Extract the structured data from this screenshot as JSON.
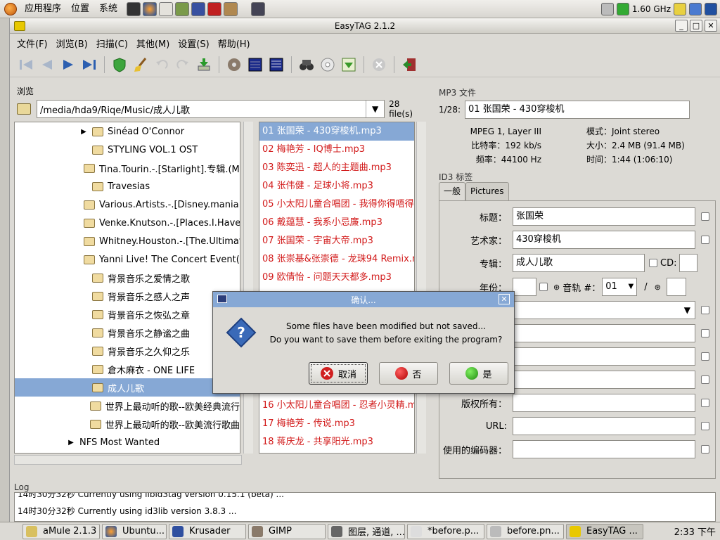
{
  "topbar": {
    "menu": [
      "应用程序",
      "位置",
      "系统"
    ],
    "cpu": "1.60 GHz"
  },
  "window": {
    "title": "EasyTAG 2.1.2"
  },
  "menubar": [
    "文件(F)",
    "浏览(B)",
    "扫描(C)",
    "其他(M)",
    "设置(S)",
    "帮助(H)"
  ],
  "browser": {
    "title": "浏览",
    "path": "/media/hda9/Riqe/Music/成人儿歌",
    "count": "28 file(s)",
    "tree": [
      {
        "label": "Sinéad O'Connor",
        "indent": 1,
        "expander": true
      },
      {
        "label": "STYLING VOL.1 OST",
        "indent": 1
      },
      {
        "label": "Tina.Tourin.-.[Starlight].专辑.(MP",
        "indent": 1
      },
      {
        "label": "Travesias",
        "indent": 1
      },
      {
        "label": "Various.Artists.-.[Disney.mania.5",
        "indent": 1
      },
      {
        "label": "Venke.Knutson.-.[Places.I.Have.B",
        "indent": 1
      },
      {
        "label": "Whitney.Houston.-.[The.Ultimat",
        "indent": 1
      },
      {
        "label": "Yanni Live! The Concert Event(3",
        "indent": 1
      },
      {
        "label": "背景音乐之爱情之歌",
        "indent": 1
      },
      {
        "label": "背景音乐之感人之声",
        "indent": 1
      },
      {
        "label": "背景音乐之恢弘之章",
        "indent": 1
      },
      {
        "label": "背景音乐之静谧之曲",
        "indent": 1
      },
      {
        "label": "背景音乐之久仰之乐",
        "indent": 1
      },
      {
        "label": "倉木麻衣 - ONE LIFE",
        "indent": 1
      },
      {
        "label": "成人儿歌",
        "indent": 1,
        "selected": true
      },
      {
        "label": "世界上最动听的歌--欧美经典流行",
        "indent": 1
      },
      {
        "label": "世界上最动听的歌--欧美流行歌曲",
        "indent": 1
      },
      {
        "label": "NFS Most Wanted",
        "indent": 0,
        "expander": true,
        "nofolder": true
      }
    ],
    "files": [
      {
        "label": "01 张国荣 - 430穿梭机.mp3",
        "selected": true
      },
      {
        "label": "02 梅艳芳 - IQ博士.mp3"
      },
      {
        "label": "03 陈奕迅 - 超人的主题曲.mp3"
      },
      {
        "label": "04 张伟健 - 足球小将.mp3"
      },
      {
        "label": "05 小太阳儿童合唱团 - 我得你得唔得"
      },
      {
        "label": "06 戴蕴慧 - 我系小忌廉.mp3"
      },
      {
        "label": "07 张国荣 - 宇宙大帝.mp3"
      },
      {
        "label": "08 张崇基&张崇德 - 龙珠94 Remix.n"
      },
      {
        "label": "09 欧倩怡 - 问题天天都多.mp3"
      },
      {
        "label": ""
      },
      {
        "label": ""
      },
      {
        "label": ""
      },
      {
        "label": ""
      },
      {
        "label": ""
      },
      {
        "label": ""
      },
      {
        "label": "16 小太阳儿童合唱团 - 忍者小灵精.m"
      },
      {
        "label": "17 梅艳芳 - 传说.mp3"
      },
      {
        "label": "18 蒋庆龙 - 共享阳光.mp3"
      }
    ]
  },
  "mp3": {
    "title": "MP3 文件",
    "position": "1/28:",
    "filename": "01 张国荣 - 430穿梭机",
    "left": [
      "MPEG 1, Layer III",
      "比特率：192 kb/s",
      "频率：44100 Hz"
    ],
    "right": [
      "模式：Joint stereo",
      "大小：2.4 MB (91.4 MB)",
      "时间：1:44 (1:06:10)"
    ]
  },
  "id3": {
    "title": "ID3 标签",
    "tabs": [
      "一般",
      "Pictures"
    ],
    "fields": [
      {
        "label": "标题：",
        "value": "张国荣"
      },
      {
        "label": "艺术家：",
        "value": "430穿梭机"
      },
      {
        "label": "专辑：",
        "value": "成人儿歌"
      }
    ],
    "cd_label": "CD:",
    "year_label": "年份：",
    "track_label": "音轨 #：",
    "track_value": "01",
    "track_sep": "/",
    "lower": [
      {
        "label": "版权所有：",
        "value": ""
      },
      {
        "label": "URL:",
        "value": ""
      },
      {
        "label": "使用的编码器：",
        "value": ""
      }
    ]
  },
  "log": {
    "title": "Log",
    "lines": [
      "14时30分32秒  Currently using libid3tag version 0.15.1 (beta) ...",
      "14时30分32秒  Currently using id3lib version 3.8.3 ..."
    ]
  },
  "dialog": {
    "title": "确认...",
    "line1": "Some files have been modified but not saved...",
    "line2": "Do you want to save them before exiting the program?",
    "cancel": "取消",
    "no": "否",
    "yes": "是"
  },
  "taskbar": {
    "tasks": [
      "aMule 2.1.3",
      "Ubuntu...",
      "Krusader",
      "GIMP",
      "图层, 通道, ...",
      "*before.p...",
      "before.pn...",
      "EasyTAG ..."
    ],
    "clock": "2:33 下午"
  }
}
